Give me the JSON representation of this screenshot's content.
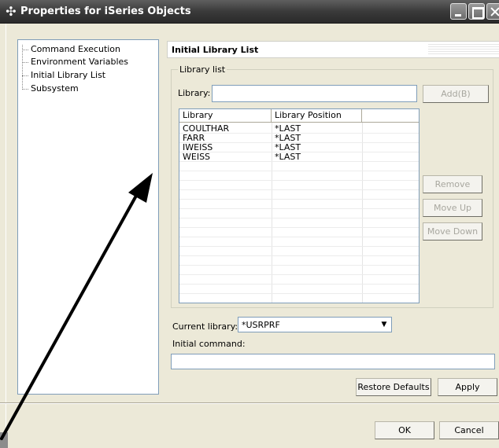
{
  "window": {
    "title": "Properties for iSeries Objects",
    "icon": "properties-icon"
  },
  "tree": {
    "items": [
      "Command Execution",
      "Environment Variables",
      "Initial Library List",
      "Subsystem"
    ]
  },
  "panel": {
    "title": "Initial Library List",
    "group_label": "Library list",
    "library_label": "Library:",
    "library_value": "",
    "add_label": "Add(B)",
    "remove_label": "Remove",
    "move_up_label": "Move Up",
    "move_down_label": "Move Down",
    "table": {
      "columns": [
        "Library",
        "Library Position",
        ""
      ],
      "rows": [
        [
          "COULTHAR",
          "*LAST"
        ],
        [
          "FARR",
          "*LAST"
        ],
        [
          "IWEISS",
          "*LAST"
        ],
        [
          "WEISS",
          "*LAST"
        ]
      ]
    },
    "current_library_label": "Current library:",
    "current_library_value": "*USRPRF",
    "initial_command_label": "Initial command:",
    "initial_command_value": "",
    "restore_defaults_label": "Restore Defaults",
    "apply_label": "Apply"
  },
  "footer": {
    "ok_label": "OK",
    "cancel_label": "Cancel"
  }
}
